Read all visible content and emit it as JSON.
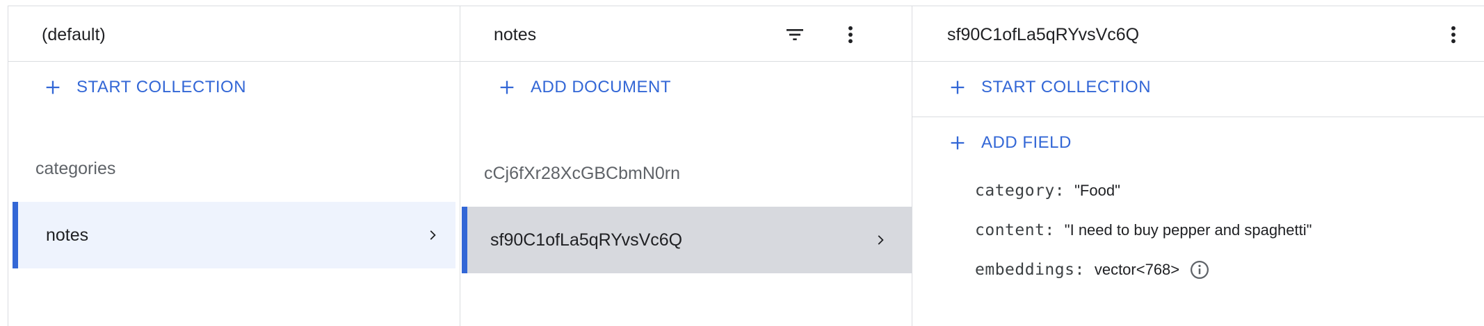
{
  "colors": {
    "accent": "#3367d6",
    "selected_bg_light": "#eef3fd",
    "selected_bg_gray": "#d7d9de",
    "selected_bar": "#3367d6",
    "border": "#dadce0"
  },
  "root_panel": {
    "title": "(default)",
    "start_collection_label": "START COLLECTION",
    "items": [
      {
        "label": "categories"
      },
      {
        "label": "notes"
      }
    ]
  },
  "collection_panel": {
    "title": "notes",
    "filter_icon": "filter-list-icon",
    "menu_icon": "more-vert-icon",
    "add_document_label": "ADD DOCUMENT",
    "items": [
      {
        "label": "cCj6fXr28XcGBCbmN0rn"
      },
      {
        "label": "sf90C1ofLa5qRYvsVc6Q"
      }
    ]
  },
  "document_panel": {
    "title": "sf90C1ofLa5qRYvsVc6Q",
    "menu_icon": "more-vert-icon",
    "start_collection_label": "START COLLECTION",
    "add_field_label": "ADD FIELD",
    "fields": [
      {
        "key": "category:",
        "value": "\"Food\""
      },
      {
        "key": "content:",
        "value": "\"I need to buy pepper and spaghetti\""
      },
      {
        "key": "embeddings:",
        "value": "vector<768>",
        "icon": "info-icon"
      }
    ]
  }
}
